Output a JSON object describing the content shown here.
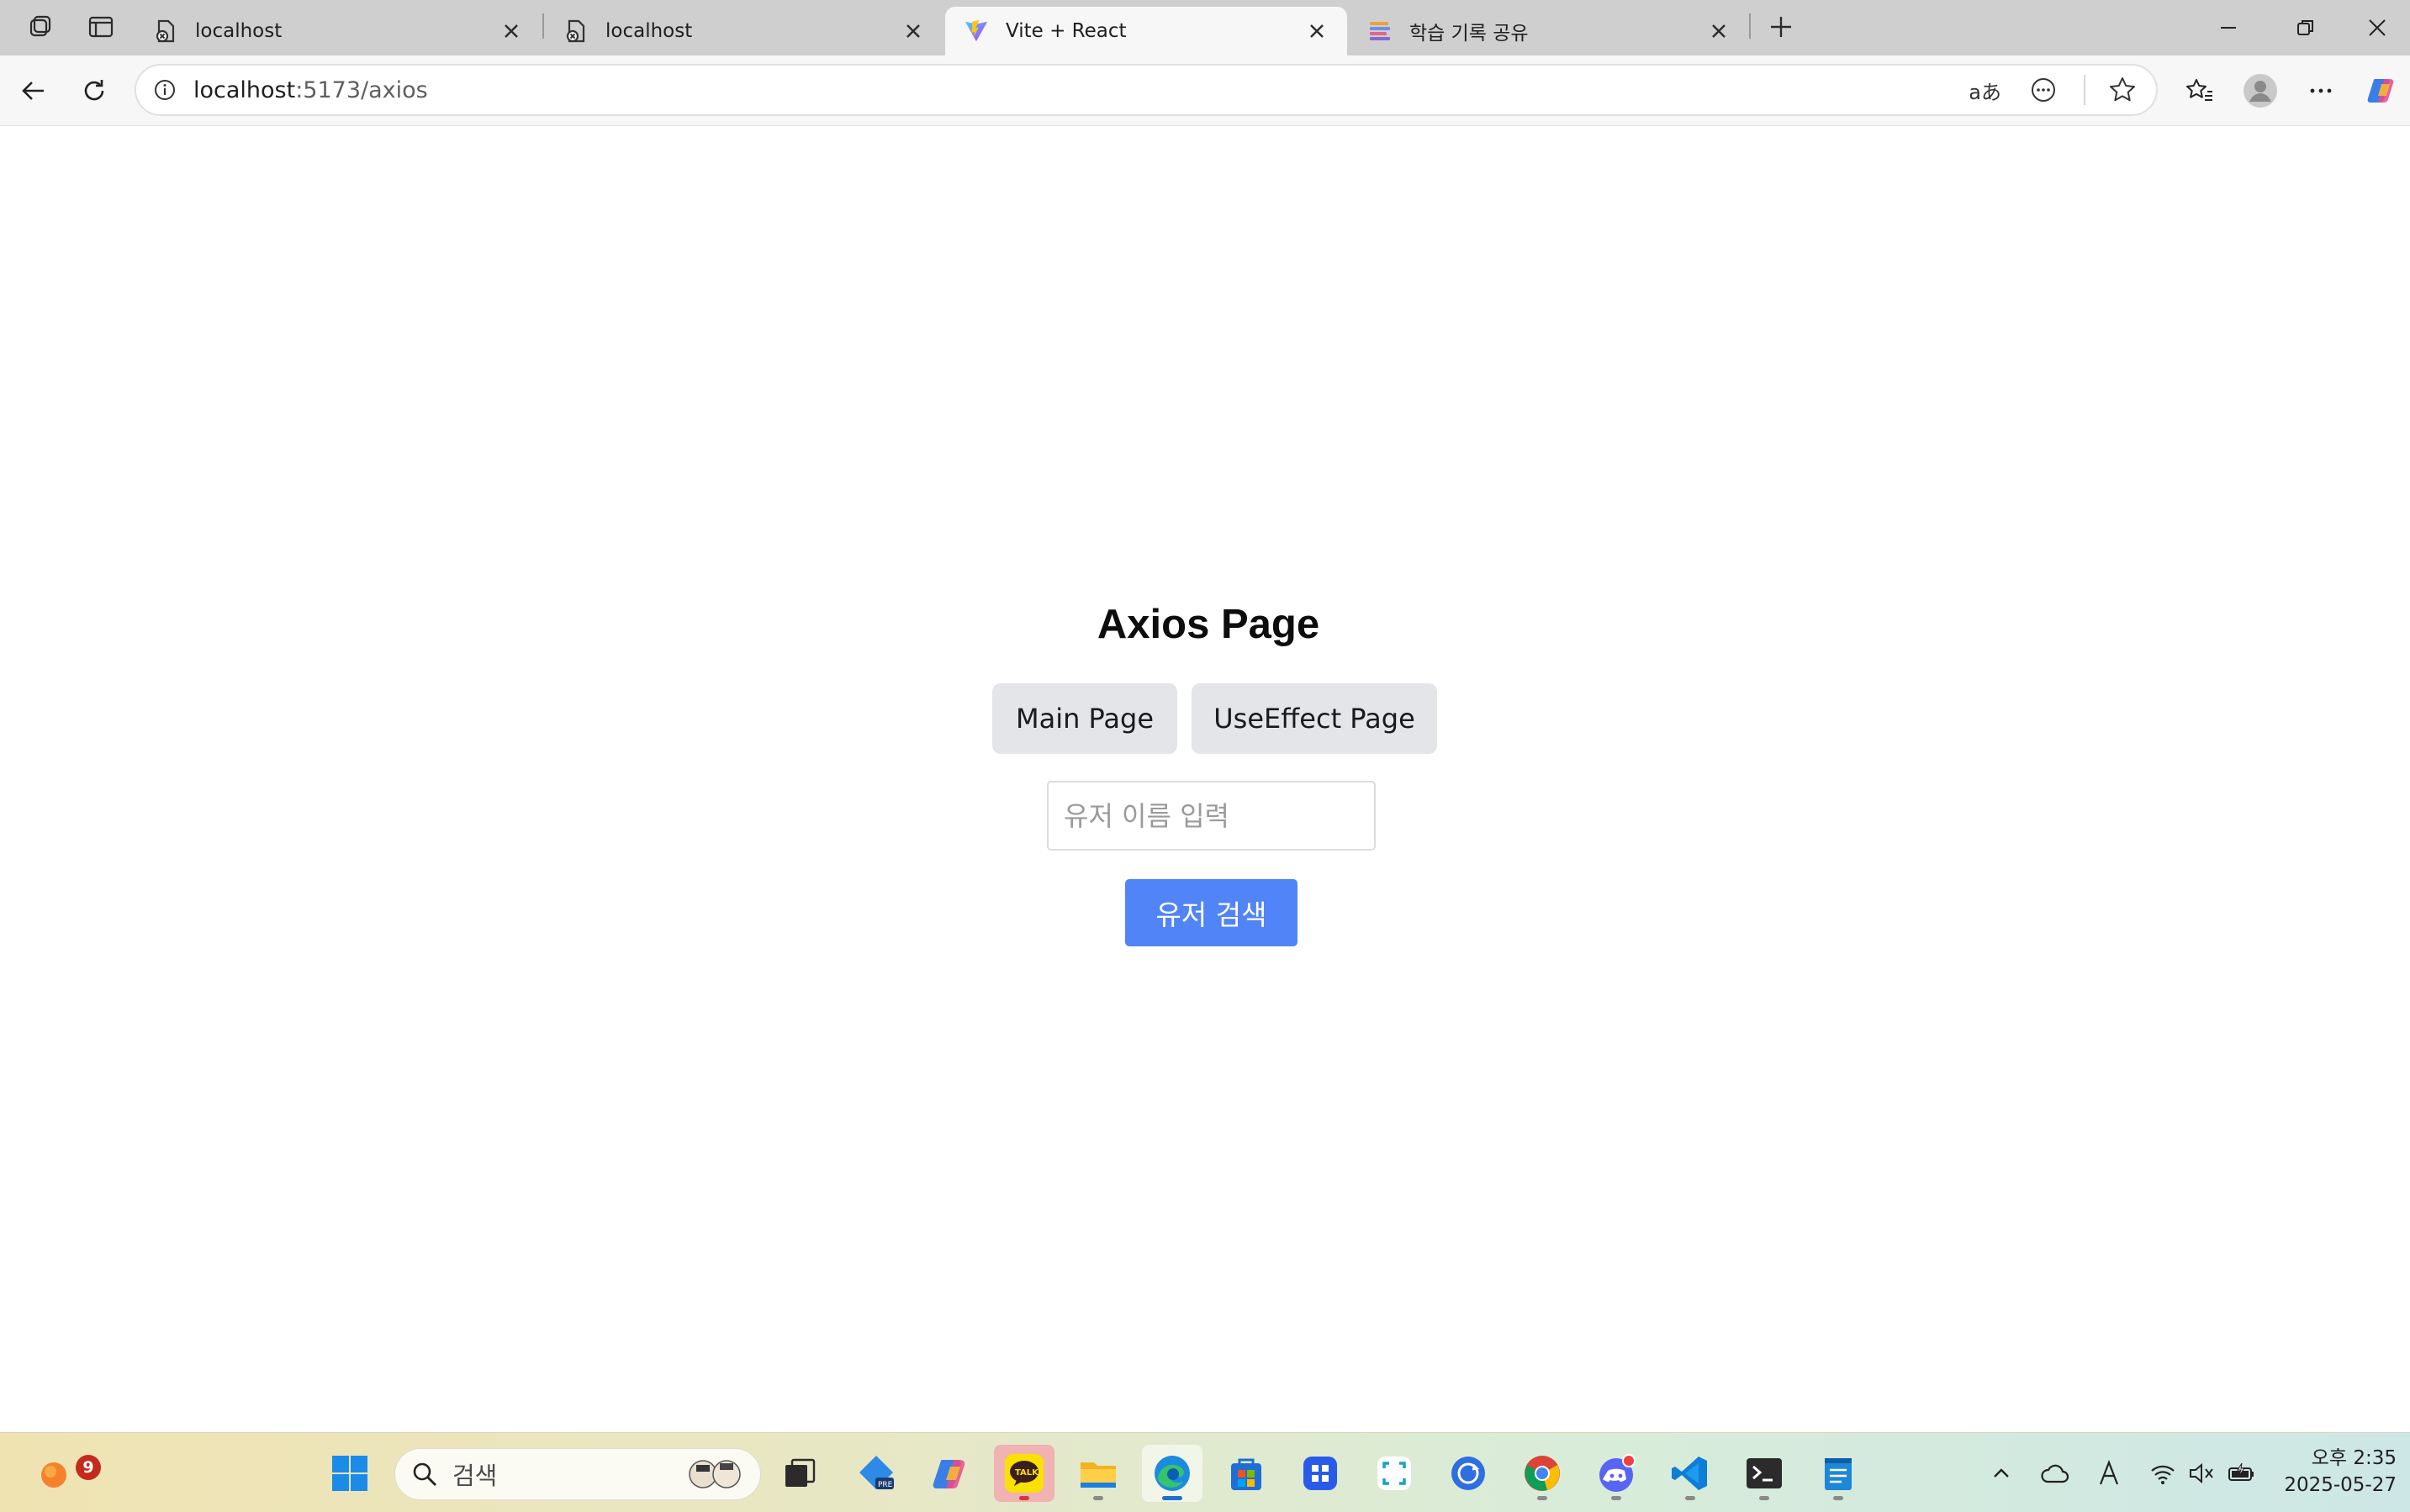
{
  "browser": {
    "tabs": [
      {
        "title": "localhost",
        "icon": "file-error-icon"
      },
      {
        "title": "localhost",
        "icon": "file-error-icon"
      },
      {
        "title": "Vite + React",
        "icon": "vite-logo-icon",
        "active": true
      },
      {
        "title": "학습 기록 공유",
        "icon": "stacked-lines-icon"
      }
    ],
    "url_host": "localhost",
    "url_path": ":5173/axios",
    "read_aloud_label": "aあ"
  },
  "page": {
    "title": "Axios Page",
    "nav_buttons": [
      {
        "label": "Main Page"
      },
      {
        "label": "UseEffect Page"
      }
    ],
    "search": {
      "placeholder": "유저 이름 입력",
      "value": "",
      "button_label": "유저 검색"
    },
    "colors": {
      "accent": "#5184f7",
      "nav_button_bg": "#e4e5e9"
    }
  },
  "taskbar": {
    "search_placeholder": "검색",
    "weather_badge": "9",
    "apps": [
      "edge-pre-icon",
      "copilot-icon",
      "kakaotalk-icon",
      "file-explorer-icon",
      "edge-icon",
      "store-icon",
      "dev-home-icon",
      "snipping-tool-icon",
      "sync-icon",
      "chrome-icon",
      "discord-icon",
      "vscode-icon",
      "terminal-icon",
      "notepad-icon"
    ],
    "clock_time": "오후 2:35",
    "clock_date": "2025-05-27"
  }
}
